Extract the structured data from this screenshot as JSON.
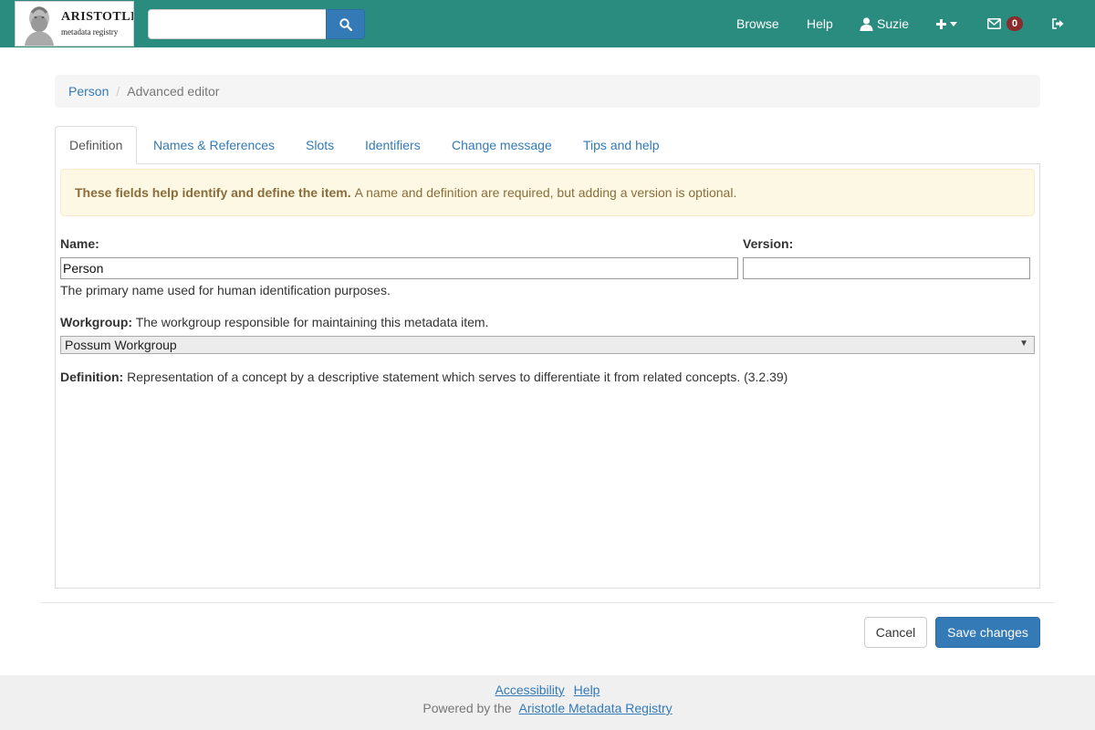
{
  "navbar": {
    "logo_title": "ARISTOTLE",
    "logo_subtitle": "metadata registry",
    "search_value": "",
    "browse": "Browse",
    "help": "Help",
    "user": "Suzie",
    "notifications_count": "0"
  },
  "breadcrumb": {
    "parent": "Person",
    "current": "Advanced editor"
  },
  "tabs": [
    {
      "label": "Definition",
      "active": true
    },
    {
      "label": "Names & References"
    },
    {
      "label": "Slots"
    },
    {
      "label": "Identifiers"
    },
    {
      "label": "Change message"
    },
    {
      "label": "Tips and help"
    }
  ],
  "alert": {
    "strong": "These fields help identify and define the item.",
    "text": "A name and definition are required, but adding a version is optional."
  },
  "form": {
    "name_label": "Name:",
    "name_value": "Person",
    "name_help": "The primary name used for human identification purposes.",
    "version_label": "Version:",
    "version_value": "",
    "workgroup_label": "Workgroup:",
    "workgroup_help": "The workgroup responsible for maintaining this metadata item.",
    "workgroup_selected": "Possum Workgroup",
    "definition_label": "Definition:",
    "definition_help": "Representation of a concept by a descriptive statement which serves to differentiate it from related concepts. (3.2.39)"
  },
  "actions": {
    "cancel": "Cancel",
    "save": "Save changes"
  },
  "footer": {
    "accessibility": "Accessibility",
    "help": "Help",
    "powered_by": "Powered by the",
    "registry_link": "Aristotle Metadata Registry"
  },
  "colors": {
    "navbar": "#2a8c7e",
    "primary": "#337ab7",
    "alert_bg": "#fcf8e3"
  }
}
